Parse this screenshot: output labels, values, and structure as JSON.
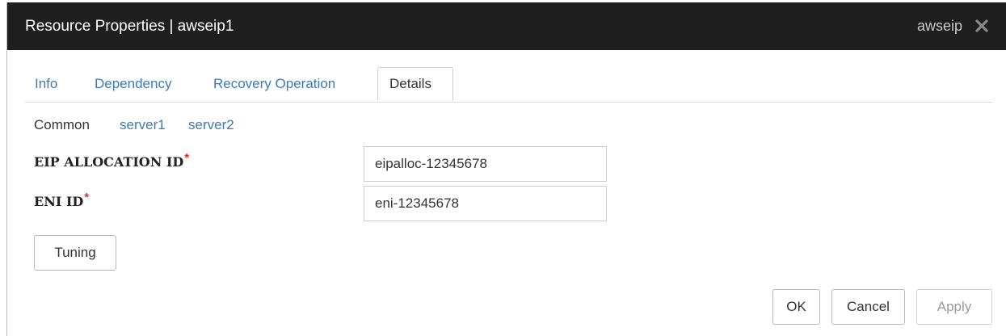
{
  "dialog": {
    "title": "Resource Properties | awseip1",
    "resource_type": "awseip",
    "close_icon": "close-icon"
  },
  "tabs": [
    {
      "label": "Info",
      "active": false
    },
    {
      "label": "Dependency",
      "active": false
    },
    {
      "label": "Recovery Operation",
      "active": false
    },
    {
      "label": "Details",
      "active": true
    }
  ],
  "subtabs": [
    {
      "label": "Common",
      "active": true
    },
    {
      "label": "server1",
      "active": false
    },
    {
      "label": "server2",
      "active": false
    }
  ],
  "fields": {
    "eip_allocation_id": {
      "label": "EIP ALLOCATION ID",
      "required_mark": "*",
      "value": "eipalloc-12345678"
    },
    "eni_id": {
      "label": "ENI ID",
      "required_mark": "*",
      "value": "eni-12345678"
    }
  },
  "buttons": {
    "tuning": "Tuning",
    "ok": "OK",
    "cancel": "Cancel",
    "apply": "Apply"
  },
  "colors": {
    "titlebar": "#1f1f1f",
    "link": "#3a7ab8",
    "required": "#e03030"
  }
}
